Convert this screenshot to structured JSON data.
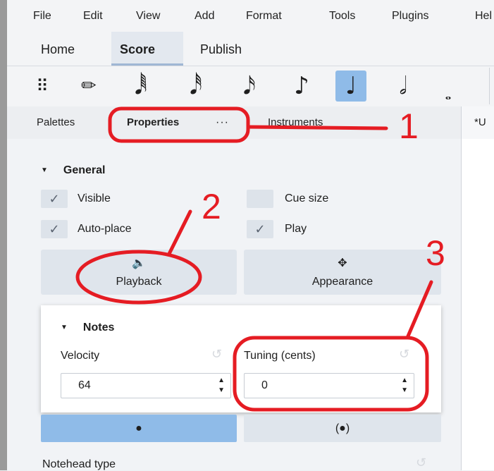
{
  "menubar": {
    "items": [
      "File",
      "Edit",
      "View",
      "Add",
      "Format",
      "Tools",
      "Plugins",
      "Hel"
    ]
  },
  "workspace_tabs": [
    {
      "label": "Home",
      "active": false
    },
    {
      "label": "Score",
      "active": true
    },
    {
      "label": "Publish",
      "active": false
    }
  ],
  "toolbar": {
    "tools": [
      {
        "icon": "drag-handle-icon",
        "glyph": "⠿"
      },
      {
        "icon": "pencil-icon",
        "glyph": "✏"
      },
      {
        "icon": "sixty-fourth-note-icon",
        "glyph": "𝅘𝅥𝅱"
      },
      {
        "icon": "thirty-second-note-icon",
        "glyph": "𝅘𝅥𝅰"
      },
      {
        "icon": "sixteenth-note-icon",
        "glyph": "𝅘𝅥𝅯"
      },
      {
        "icon": "eighth-note-icon",
        "glyph": "♪"
      },
      {
        "icon": "quarter-note-icon",
        "glyph": "♩",
        "active": true
      },
      {
        "icon": "half-note-icon",
        "glyph": "𝅗𝅥"
      },
      {
        "icon": "whole-note-icon",
        "glyph": "𝅝"
      }
    ]
  },
  "panel_tabs": {
    "palettes": "Palettes",
    "properties": "Properties",
    "more": "···",
    "instruments": "Instruments",
    "score": "*U"
  },
  "general": {
    "title": "General",
    "visible": {
      "label": "Visible",
      "checked": true
    },
    "cue_size": {
      "label": "Cue size",
      "checked": false
    },
    "auto_place": {
      "label": "Auto-place",
      "checked": true
    },
    "play": {
      "label": "Play",
      "checked": true
    },
    "playback_button": {
      "label": "Playback",
      "icon": "speaker-icon"
    },
    "appearance_button": {
      "label": "Appearance",
      "icon": "move-arrows-icon"
    }
  },
  "notes": {
    "title": "Notes",
    "velocity": {
      "label": "Velocity",
      "value": "64"
    },
    "tuning": {
      "label": "Tuning (cents)",
      "value": "0"
    }
  },
  "notehead": {
    "normal_glyph": "●",
    "parentheses_glyph": "(●)",
    "type_label": "Notehead type"
  },
  "annotations": [
    "1",
    "2",
    "3"
  ],
  "colors": {
    "annotation": "#e51c23",
    "active": "#8fbbe8"
  }
}
